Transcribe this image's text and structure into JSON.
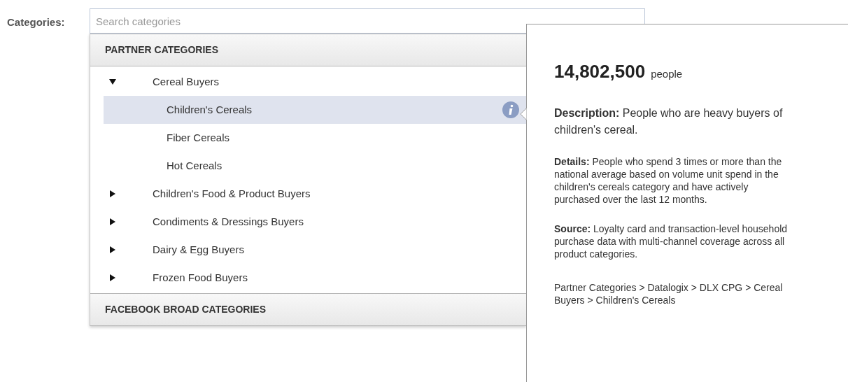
{
  "field": {
    "label": "Categories:",
    "placeholder": "Search categories"
  },
  "sections": [
    {
      "title": "PARTNER CATEGORIES",
      "items": [
        {
          "label": "Cereal Buyers",
          "expanded": true,
          "selected": false,
          "children": [
            {
              "label": "Children's Cereals",
              "selected": true
            },
            {
              "label": "Fiber Cereals",
              "selected": false
            },
            {
              "label": "Hot Cereals",
              "selected": false
            }
          ]
        },
        {
          "label": "Children's Food & Product Buyers",
          "expanded": false,
          "selected": false
        },
        {
          "label": "Condiments & Dressings Buyers",
          "expanded": false,
          "selected": false
        },
        {
          "label": "Dairy & Egg Buyers",
          "expanded": false,
          "selected": false
        },
        {
          "label": "Frozen Food Buyers",
          "expanded": false,
          "selected": false
        }
      ]
    },
    {
      "title": "FACEBOOK BROAD CATEGORIES"
    }
  ],
  "popover": {
    "count": "14,802,500",
    "unit": "people",
    "description": "**Description:** People who are heavy buyers of children's cereal.",
    "details": "**Details:** People who spend 3 times or more than the national average based on volume unit spend in the children's cereals category and have actively purchased over the last 12 months.",
    "source": "**Source:** Loyalty card and transaction-level household purchase data with multi-channel coverage across all product categories.",
    "path": "Partner Categories > Datalogix > DLX CPG > Cereal Buyers > Children's Cereals"
  }
}
